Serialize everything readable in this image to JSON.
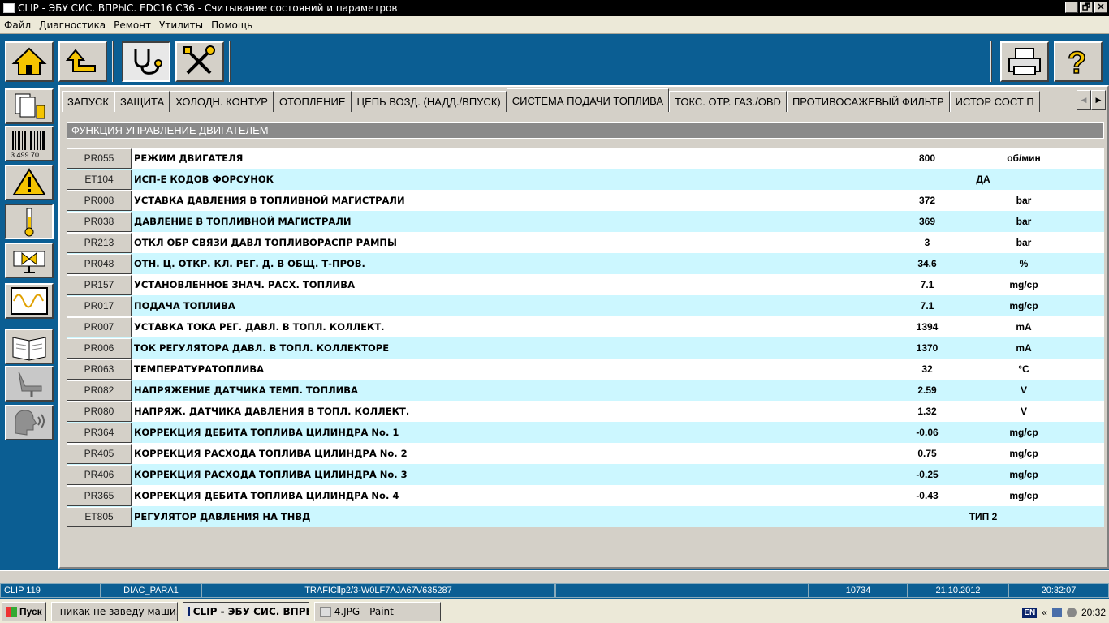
{
  "window": {
    "title": "CLIP - ЭБУ СИС. ВПРЫС. EDC16 C36 - Считывание состояний и параметров",
    "minimize": "_",
    "restore": "🗗",
    "close": "✕"
  },
  "menu": [
    "Файл",
    "Диагностика",
    "Ремонт",
    "Утилиты",
    "Помощь"
  ],
  "toolbar": {
    "icons": [
      "home-icon",
      "back-arrow-icon",
      "stethoscope-icon",
      "tools-icon",
      "printer-icon",
      "help-icon"
    ]
  },
  "tabs": [
    {
      "label": "ЗАПУСК",
      "active": false
    },
    {
      "label": "ЗАЩИТА",
      "active": false
    },
    {
      "label": "ХОЛОДН. КОНТУР",
      "active": false
    },
    {
      "label": "ОТОПЛЕНИЕ",
      "active": false
    },
    {
      "label": "ЦЕПЬ ВОЗД. (НАДД./ВПУСК)",
      "active": false
    },
    {
      "label": "СИСТЕМА ПОДАЧИ ТОПЛИВА",
      "active": true
    },
    {
      "label": "ТОКС. ОТР. ГАЗ./OBD",
      "active": false
    },
    {
      "label": "ПРОТИВОСАЖЕВЫЙ ФИЛЬТР",
      "active": false
    },
    {
      "label": "ИСТОР СОСТ П",
      "active": false
    }
  ],
  "section": {
    "title": "ФУНКЦИЯ УПРАВЛЕНИЕ ДВИГАТЕЛЕМ"
  },
  "parameters": [
    {
      "code": "PR055",
      "label": "РЕЖИМ ДВИГАТЕЛЯ",
      "value": "800",
      "unit": "об/мин"
    },
    {
      "code": "ET104",
      "label": "ИСП-Е КОДОВ ФОРСУНОК",
      "value": "ДА",
      "unit": ""
    },
    {
      "code": "PR008",
      "label": "УСТАВКА ДАВЛЕНИЯ В ТОПЛИВНОЙ МАГИСТРАЛИ",
      "value": "372",
      "unit": "bar"
    },
    {
      "code": "PR038",
      "label": "ДАВЛЕНИЕ В ТОПЛИВНОЙ МАГИСТРАЛИ",
      "value": "369",
      "unit": "bar"
    },
    {
      "code": "PR213",
      "label": "ОТКЛ ОБР СВЯЗИ ДАВЛ ТОПЛИВОРАСПР РАМПЫ",
      "value": "3",
      "unit": "bar"
    },
    {
      "code": "PR048",
      "label": "ОТН. Ц. ОТКР. КЛ. РЕГ. Д. В ОБЩ. Т-ПРОВ.",
      "value": "34.6",
      "unit": "%"
    },
    {
      "code": "PR157",
      "label": "УСТАНОВЛЕННОЕ ЗНАЧ. РАСХ. ТОПЛИВА",
      "value": "7.1",
      "unit": "mg/cp"
    },
    {
      "code": "PR017",
      "label": "ПОДАЧА ТОПЛИВА",
      "value": "7.1",
      "unit": "mg/cp"
    },
    {
      "code": "PR007",
      "label": "УСТАВКА ТОКА РЕГ. ДАВЛ. В ТОПЛ. КОЛЛЕКТ.",
      "value": "1394",
      "unit": "mA"
    },
    {
      "code": "PR006",
      "label": "ТОК РЕГУЛЯТОРА ДАВЛ. В ТОПЛ. КОЛЛЕКТОРЕ",
      "value": "1370",
      "unit": "mA"
    },
    {
      "code": "PR063",
      "label": "ТЕМПЕРАТУРАТОПЛИВА",
      "value": "32",
      "unit": "°C"
    },
    {
      "code": "PR082",
      "label": "НАПРЯЖЕНИЕ ДАТЧИКА ТЕМП. ТОПЛИВА",
      "value": "2.59",
      "unit": "V"
    },
    {
      "code": "PR080",
      "label": "НАПРЯЖ. ДАТЧИКА ДАВЛЕНИЯ В ТОПЛ. КОЛЛЕКТ.",
      "value": "1.32",
      "unit": "V"
    },
    {
      "code": "PR364",
      "label": "КОРРЕКЦИЯ ДЕБИТА ТОПЛИВА ЦИЛИНДРА No. 1",
      "value": "-0.06",
      "unit": "mg/cp"
    },
    {
      "code": "PR405",
      "label": "КОРРЕКЦИЯ РАСХОДА ТОПЛИВА ЦИЛИНДРА No. 2",
      "value": "0.75",
      "unit": "mg/cp"
    },
    {
      "code": "PR406",
      "label": "КОРРЕКЦИЯ РАСХОДА ТОПЛИВА ЦИЛИНДРА No. 3",
      "value": "-0.25",
      "unit": "mg/cp"
    },
    {
      "code": "PR365",
      "label": "КОРРЕКЦИЯ ДЕБИТА ТОПЛИВА ЦИЛИНДРА No. 4",
      "value": "-0.43",
      "unit": "mg/cp"
    },
    {
      "code": "ET805",
      "label": "РЕГУЛЯТОР ДАВЛЕНИЯ НА ТНВД",
      "value": "ТИП 2",
      "unit": ""
    }
  ],
  "statusbar": [
    "CLIP 119",
    "DIAC_PARA1",
    "TRAFICllp2/3-W0LF7AJA67V635287",
    "",
    "10734",
    "21.10.2012",
    "20:32:07"
  ],
  "taskbar": {
    "start": "Пуск",
    "items": [
      {
        "label": "никак не заведу маши...",
        "active": false
      },
      {
        "label": "CLIP - ЭБУ СИС. ВПРЫ...",
        "active": true
      },
      {
        "label": "4.JPG - Paint",
        "active": false
      }
    ],
    "lang": "EN",
    "chevron": "«",
    "clock": "20:32"
  },
  "left_panel": {
    "barcode_text": "3 499 70"
  }
}
